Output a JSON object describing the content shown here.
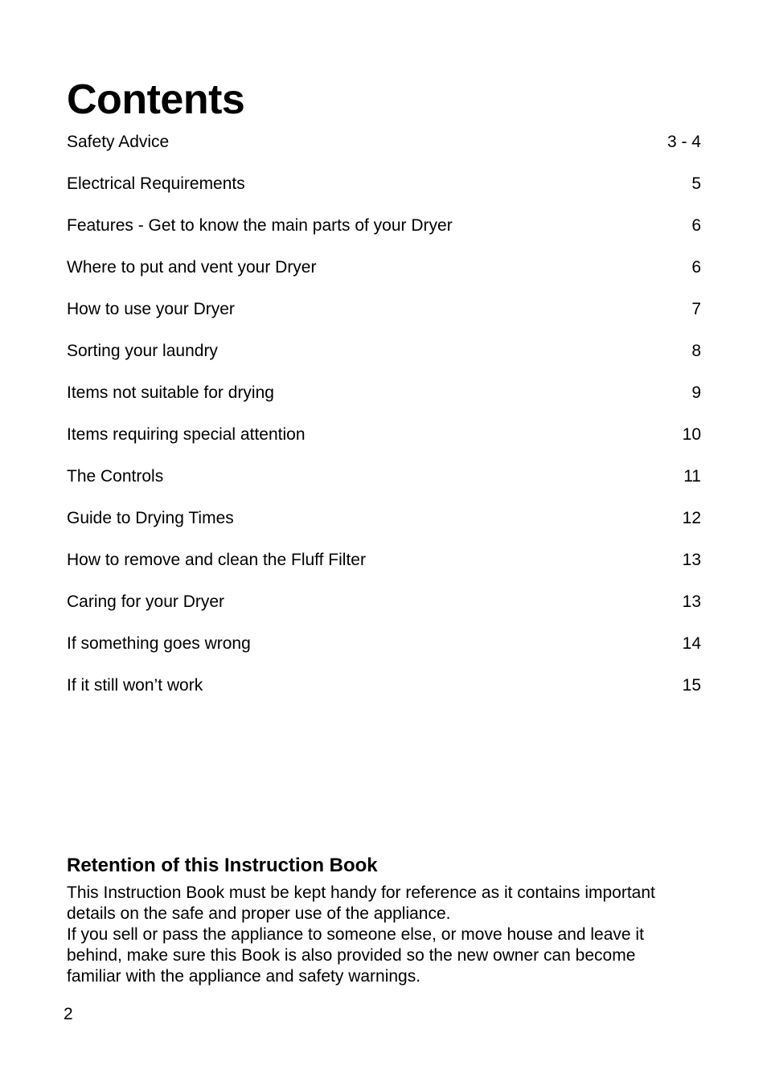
{
  "document": {
    "title": "Contents",
    "folio": "2"
  },
  "toc": {
    "entries": [
      {
        "label": "Safety Advice",
        "page": "3 - 4"
      },
      {
        "label": "Electrical Requirements",
        "page": "5"
      },
      {
        "label": "Features - Get to know the main parts of your Dryer",
        "page": "6"
      },
      {
        "label": "Where to put and vent your Dryer",
        "page": "6"
      },
      {
        "label": "How to use your Dryer",
        "page": "7"
      },
      {
        "label": "Sorting your laundry",
        "page": "8"
      },
      {
        "label": "Items not suitable for drying",
        "page": "9"
      },
      {
        "label": "Items requiring special attention",
        "page": "10"
      },
      {
        "label": "The Controls",
        "page": "11"
      },
      {
        "label": "Guide to Drying Times",
        "page": "12"
      },
      {
        "label": "How to remove and clean the Fluff Filter",
        "page": "13"
      },
      {
        "label": "Caring for your Dryer",
        "page": "13"
      },
      {
        "label": "If something goes wrong",
        "page": "14"
      },
      {
        "label": "If it still won’t work",
        "page": "15"
      }
    ]
  },
  "retention": {
    "heading": "Retention of this Instruction Book",
    "lines": [
      "This Instruction Book must be kept handy for reference as it contains important",
      "details on the safe and proper use of the appliance.",
      "If you sell or pass the appliance to someone else, or move house and leave it",
      "behind, make sure this Book is also provided so the new owner can become",
      "familiar with the appliance and safety warnings."
    ]
  }
}
